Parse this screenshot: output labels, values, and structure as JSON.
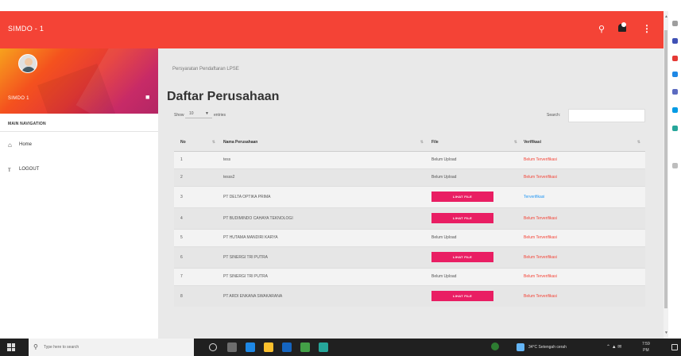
{
  "appbar": {
    "title": "SIMDO - 1",
    "search_icon": "search-icon",
    "notification_icon": "bell-icon",
    "menu_icon": "more-vert-icon"
  },
  "sidebar": {
    "user_name": "SIMDO 1",
    "nav_header": "MAIN NAVIGATION",
    "items": [
      {
        "label": "Home",
        "icon": "home-icon"
      },
      {
        "label": "LOGOUT",
        "icon": "logout-icon"
      }
    ]
  },
  "main": {
    "breadcrumb": "Persyaratan Pendaftaran LPSE",
    "title": "Daftar Perusahaan",
    "length_label": "Show",
    "length_value": "10",
    "length_after": "entries",
    "search_label": "Search:",
    "table": {
      "columns": [
        "No",
        "Nama Perusahaan",
        "File",
        "Verifikasi"
      ],
      "rows": [
        {
          "no": "1",
          "name": "tess",
          "file": "Belum Upload",
          "file_is_button": false,
          "status": "Belum Terverifikasi",
          "verified": false
        },
        {
          "no": "2",
          "name": "tesss2",
          "file": "Belum Upload",
          "file_is_button": false,
          "status": "Belum Terverifikasi",
          "verified": false
        },
        {
          "no": "3",
          "name": "PT DELTA OPTIKA PRIMA",
          "file": "LIHAT FILE",
          "file_is_button": true,
          "status": "Terverifikasi",
          "verified": true
        },
        {
          "no": "4",
          "name": "PT BUDIMINDO CAHAYA TEKNOLOGI",
          "file": "LIHAT FILE",
          "file_is_button": true,
          "status": "Belum Terverifikasi",
          "verified": false
        },
        {
          "no": "5",
          "name": "PT HUTAMA MANDIRI KARYA",
          "file": "Belum Upload",
          "file_is_button": false,
          "status": "Belum Terverifikasi",
          "verified": false
        },
        {
          "no": "6",
          "name": "PT SINERGI TRI PUTRA",
          "file": "LIHAT FILE",
          "file_is_button": true,
          "status": "Belum Terverifikasi",
          "verified": false
        },
        {
          "no": "7",
          "name": "PT SINERGI TRI PUTRA",
          "file": "Belum Upload",
          "file_is_button": false,
          "status": "Belum Terverifikasi",
          "verified": false
        },
        {
          "no": "8",
          "name": "PT ARDI ENKANA SWAKARANA",
          "file": "LIHAT FILE",
          "file_is_button": true,
          "status": "Belum Terverifikasi",
          "verified": false
        }
      ]
    }
  },
  "taskbar": {
    "search_placeholder": "Type here to search",
    "weather": "34°C  Setengah cerah",
    "time": "7:59",
    "date": "PM"
  },
  "colors": {
    "appbar": "#f44336",
    "button": "#e91e63",
    "unverified": "#f44336",
    "verified": "#2196f3"
  }
}
